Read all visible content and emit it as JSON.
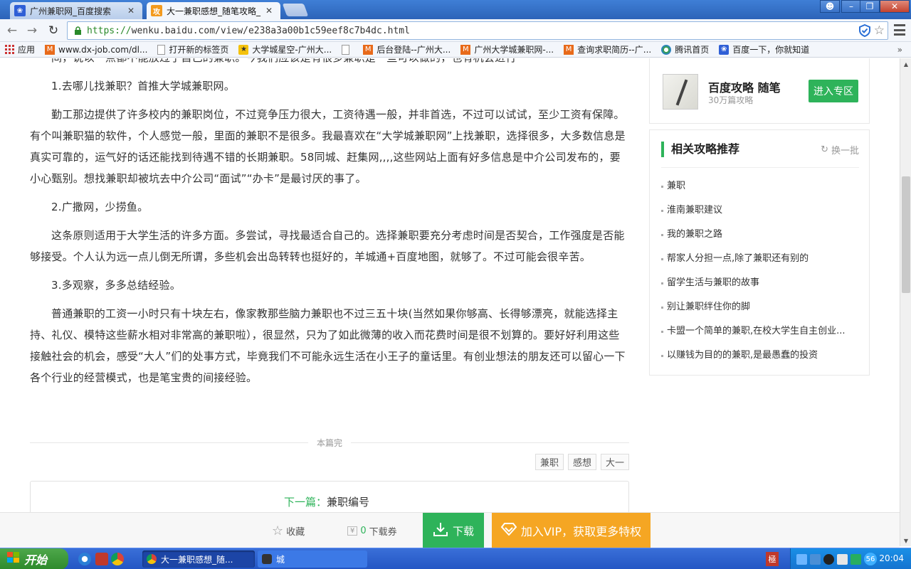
{
  "browser": {
    "tabs": [
      {
        "title": "广州兼职网_百度搜索",
        "active": false
      },
      {
        "title": "大一兼职感想_随笔攻略_",
        "active": true
      }
    ],
    "url_scheme": "https://",
    "url_rest": "wenku.baidu.com/view/e238a3a00b1c59eef8c7b4dc.html",
    "bookmarks": [
      {
        "icon": "apps-icon",
        "label": "应用"
      },
      {
        "icon": "site-icon",
        "label": "www.dx-job.com/dl..."
      },
      {
        "icon": "page-icon",
        "label": "打开新的标签页"
      },
      {
        "icon": "site-icon",
        "label": "大学城星空-广州大..."
      },
      {
        "icon": "page-icon",
        "label": ""
      },
      {
        "icon": "site-icon",
        "label": "后台登陆--广州大..."
      },
      {
        "icon": "site-icon",
        "label": "广州大学城兼职网-..."
      },
      {
        "icon": "site-icon",
        "label": "查询求职简历--广..."
      },
      {
        "icon": "qq-icon",
        "label": "腾讯首页"
      },
      {
        "icon": "baidu-icon",
        "label": "百度一下，你就知道"
      }
    ]
  },
  "article": {
    "top_partial": "间，说以一点都不能放过了自己的兼职。今我们应该是有很多兼职是一些可以做的，也有机会进行",
    "paragraphs": [
      "1.去哪儿找兼职？首推大学城兼职网。",
      "勤工那边提供了许多校内的兼职岗位，不过竞争压力很大，工资待遇一般，并非首选，不过可以试试，至少工资有保障。有个叫兼职猫的软件，个人感觉一般，里面的兼职不是很多。我最喜欢在“大学城兼职网”上找兼职，选择很多，大多数信息是真实可靠的，运气好的话还能找到待遇不错的长期兼职。58同城、赶集网,,,,这些网站上面有好多信息是中介公司发布的，要小心甄别。想找兼职却被坑去中介公司“面试”“办卡”是最讨厌的事了。",
      "2.广撒网，少捞鱼。",
      "这条原则适用于大学生活的许多方面。多尝试，寻找最适合自己的。选择兼职要充分考虑时间是否契合，工作强度是否能够接受。个人认为远一点儿倒无所谓，多些机会出岛转转也挺好的，羊城通+百度地图，就够了。不过可能会很辛苦。",
      "3.多观察，多多总结经验。",
      "普通兼职的工资一小时只有十块左右，像家教那些脑力兼职也不过三五十块(当然如果你够高、长得够漂亮，就能选择主持、礼仪、模特这些薪水相对非常高的兼职啦），很显然，只为了如此微薄的收入而花费时间是很不划算的。要好好利用这些接触社会的机会，感受“大人”们的处事方式，毕竟我们不可能永远生活在小王子的童话里。有创业想法的朋友还可以留心一下各个行业的经营模式，也是笔宝贵的间接经验。"
    ],
    "end_label": "本篇完",
    "tags": [
      "兼职",
      "感想",
      "大一"
    ],
    "next_label": "下一篇：",
    "next_title": "兼职编号"
  },
  "sidebar": {
    "brand_title": "百度攻略  随笔",
    "brand_sub": "30万篇攻略",
    "enter_button": "进入专区",
    "related_title": "相关攻略推荐",
    "refresh_label": "换一批",
    "related_items": [
      "兼职",
      "淮南兼职建议",
      "我的兼职之路",
      "帮家人分担一点,除了兼职还有别的",
      "留学生活与兼职的故事",
      "别让兼职绊住你的脚",
      "卡盟一个简单的兼职,在校大学生自主创业...",
      "以赚钱为目的的兼职,是最愚蠢的投资"
    ]
  },
  "actionbar": {
    "collect_label": "收藏",
    "coupon_count": "0",
    "coupon_label": "下载券",
    "download_label": "下载",
    "vip_label": "加入VIP，获取更多特权"
  },
  "taskbar": {
    "start_label": "开始",
    "tasks": [
      {
        "label": "大一兼职感想_随...",
        "active": true
      },
      {
        "label": "城",
        "active": false
      }
    ],
    "tray_badge": "56",
    "clock": "20:04"
  },
  "colors": {
    "accent_green": "#2eb35a",
    "vip_orange": "#f5a623",
    "chrome_blue": "#3f7fd6"
  }
}
